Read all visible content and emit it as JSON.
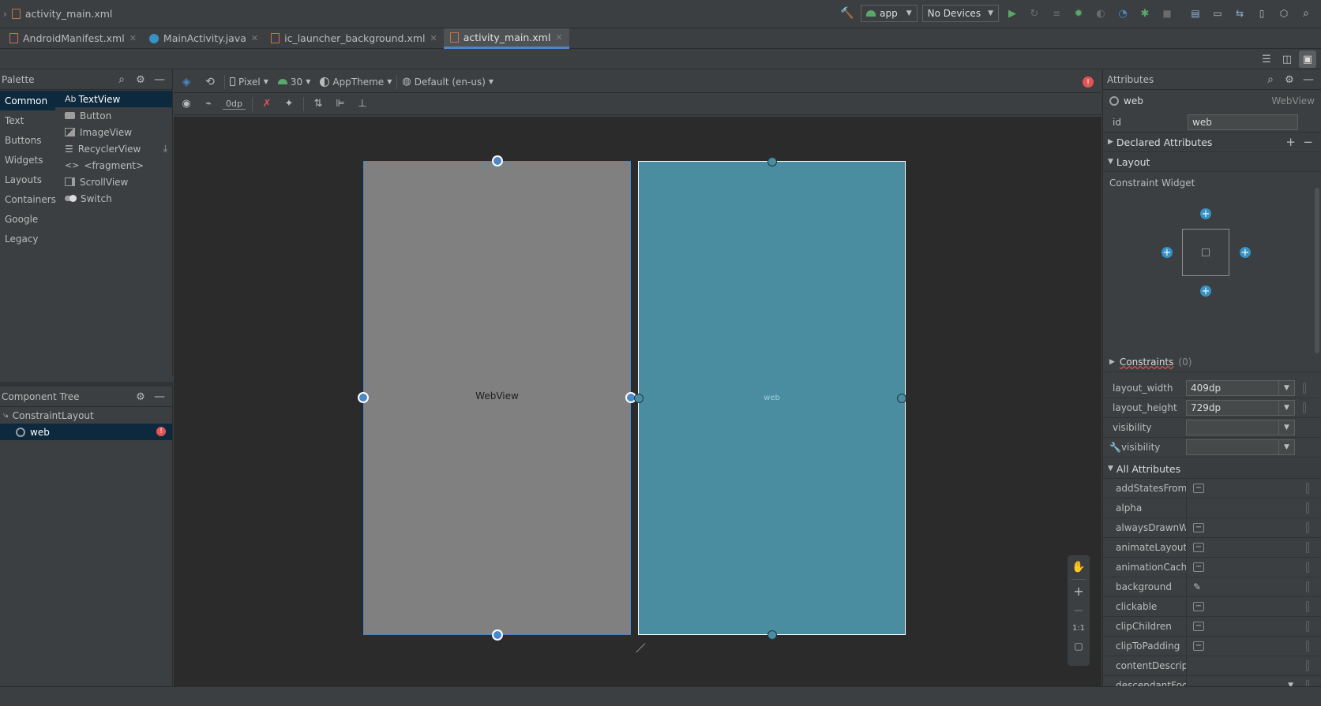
{
  "titlebar": {
    "file": "activity_main.xml",
    "run_config": "app",
    "device": "No Devices"
  },
  "tabs": [
    {
      "label": "AndroidManifest.xml",
      "icon": "xml-file-icon",
      "active": false
    },
    {
      "label": "MainActivity.java",
      "icon": "java-class-icon",
      "active": false
    },
    {
      "label": "ic_launcher_background.xml",
      "icon": "xml-file-icon",
      "active": false
    },
    {
      "label": "activity_main.xml",
      "icon": "layout-xml-icon",
      "active": true
    }
  ],
  "palette": {
    "title": "Palette",
    "categories": [
      "Common",
      "Text",
      "Buttons",
      "Widgets",
      "Layouts",
      "Containers",
      "Google",
      "Legacy"
    ],
    "items": [
      {
        "label": "TextView",
        "prefix": "Ab"
      },
      {
        "label": "Button"
      },
      {
        "label": "ImageView"
      },
      {
        "label": "RecyclerView"
      },
      {
        "label": "<fragment>"
      },
      {
        "label": "ScrollView"
      },
      {
        "label": "Switch"
      }
    ]
  },
  "design_toolbar": {
    "device": "Pixel",
    "api": "30",
    "theme": "AppTheme",
    "locale": "Default (en-us)",
    "margin": "0dp"
  },
  "component_tree": {
    "title": "Component Tree",
    "root": "ConstraintLayout",
    "child": "web"
  },
  "canvas": {
    "design_label": "WebView",
    "blueprint_label": "web",
    "zoom_label": "1:1"
  },
  "attributes": {
    "title": "Attributes",
    "component": {
      "name": "web",
      "type": "WebView"
    },
    "id_label": "id",
    "id_value": "web",
    "sections": {
      "declared": "Declared Attributes",
      "layout": "Layout",
      "constraints": "Constraints",
      "constraints_count": "(0)",
      "all": "All Attributes"
    },
    "constraint_widget": "Constraint Widget",
    "layout_fields": [
      {
        "name": "layout_width",
        "value": "409dp"
      },
      {
        "name": "layout_height",
        "value": "729dp"
      },
      {
        "name": "visibility",
        "value": ""
      },
      {
        "name": "visibility",
        "value": "",
        "tool": true
      }
    ],
    "all": [
      {
        "name": "addStatesFromC...",
        "control": "minus"
      },
      {
        "name": "alpha",
        "control": "none"
      },
      {
        "name": "alwaysDrawnWit...",
        "control": "minus"
      },
      {
        "name": "animateLayoutC...",
        "control": "minus"
      },
      {
        "name": "animationCache",
        "control": "minus"
      },
      {
        "name": "background",
        "control": "picker"
      },
      {
        "name": "clickable",
        "control": "minus"
      },
      {
        "name": "clipChildren",
        "control": "minus"
      },
      {
        "name": "clipToPadding",
        "control": "minus"
      },
      {
        "name": "contentDescripti...",
        "control": "none"
      },
      {
        "name": "descendantFocu...",
        "control": "dropdown"
      }
    ]
  },
  "colors": {
    "accent": "#4a88c7",
    "blueprint": "#4a8ca0",
    "design": "#808080",
    "run": "#59a869",
    "error": "#e05555"
  }
}
